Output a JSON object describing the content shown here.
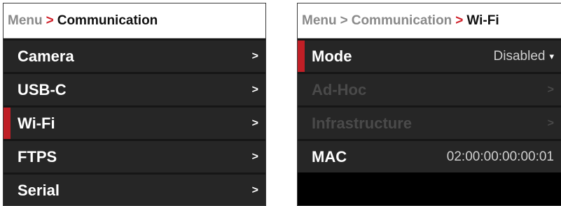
{
  "accent_color": "#c01f26",
  "left_panel": {
    "breadcrumb": {
      "root": "Menu",
      "separator": ">",
      "current": "Communication"
    },
    "items": [
      {
        "label": "Camera",
        "chevron": ">"
      },
      {
        "label": "USB-C",
        "chevron": ">"
      },
      {
        "label": "Wi-Fi",
        "chevron": ">",
        "selected": true
      },
      {
        "label": "FTPS",
        "chevron": ">"
      },
      {
        "label": "Serial",
        "chevron": ">"
      }
    ]
  },
  "right_panel": {
    "breadcrumb": {
      "root": "Menu",
      "separator_1": ">",
      "middle": "Communication",
      "separator_2": ">",
      "current": "Wi-Fi"
    },
    "mode": {
      "label": "Mode",
      "value": "Disabled",
      "arrow": "▾"
    },
    "adhoc": {
      "label": "Ad-Hoc",
      "chevron": ">"
    },
    "infrastructure": {
      "label": "Infrastructure",
      "chevron": ">"
    },
    "mac": {
      "label": "MAC",
      "value": "02:00:00:00:00:01"
    }
  }
}
